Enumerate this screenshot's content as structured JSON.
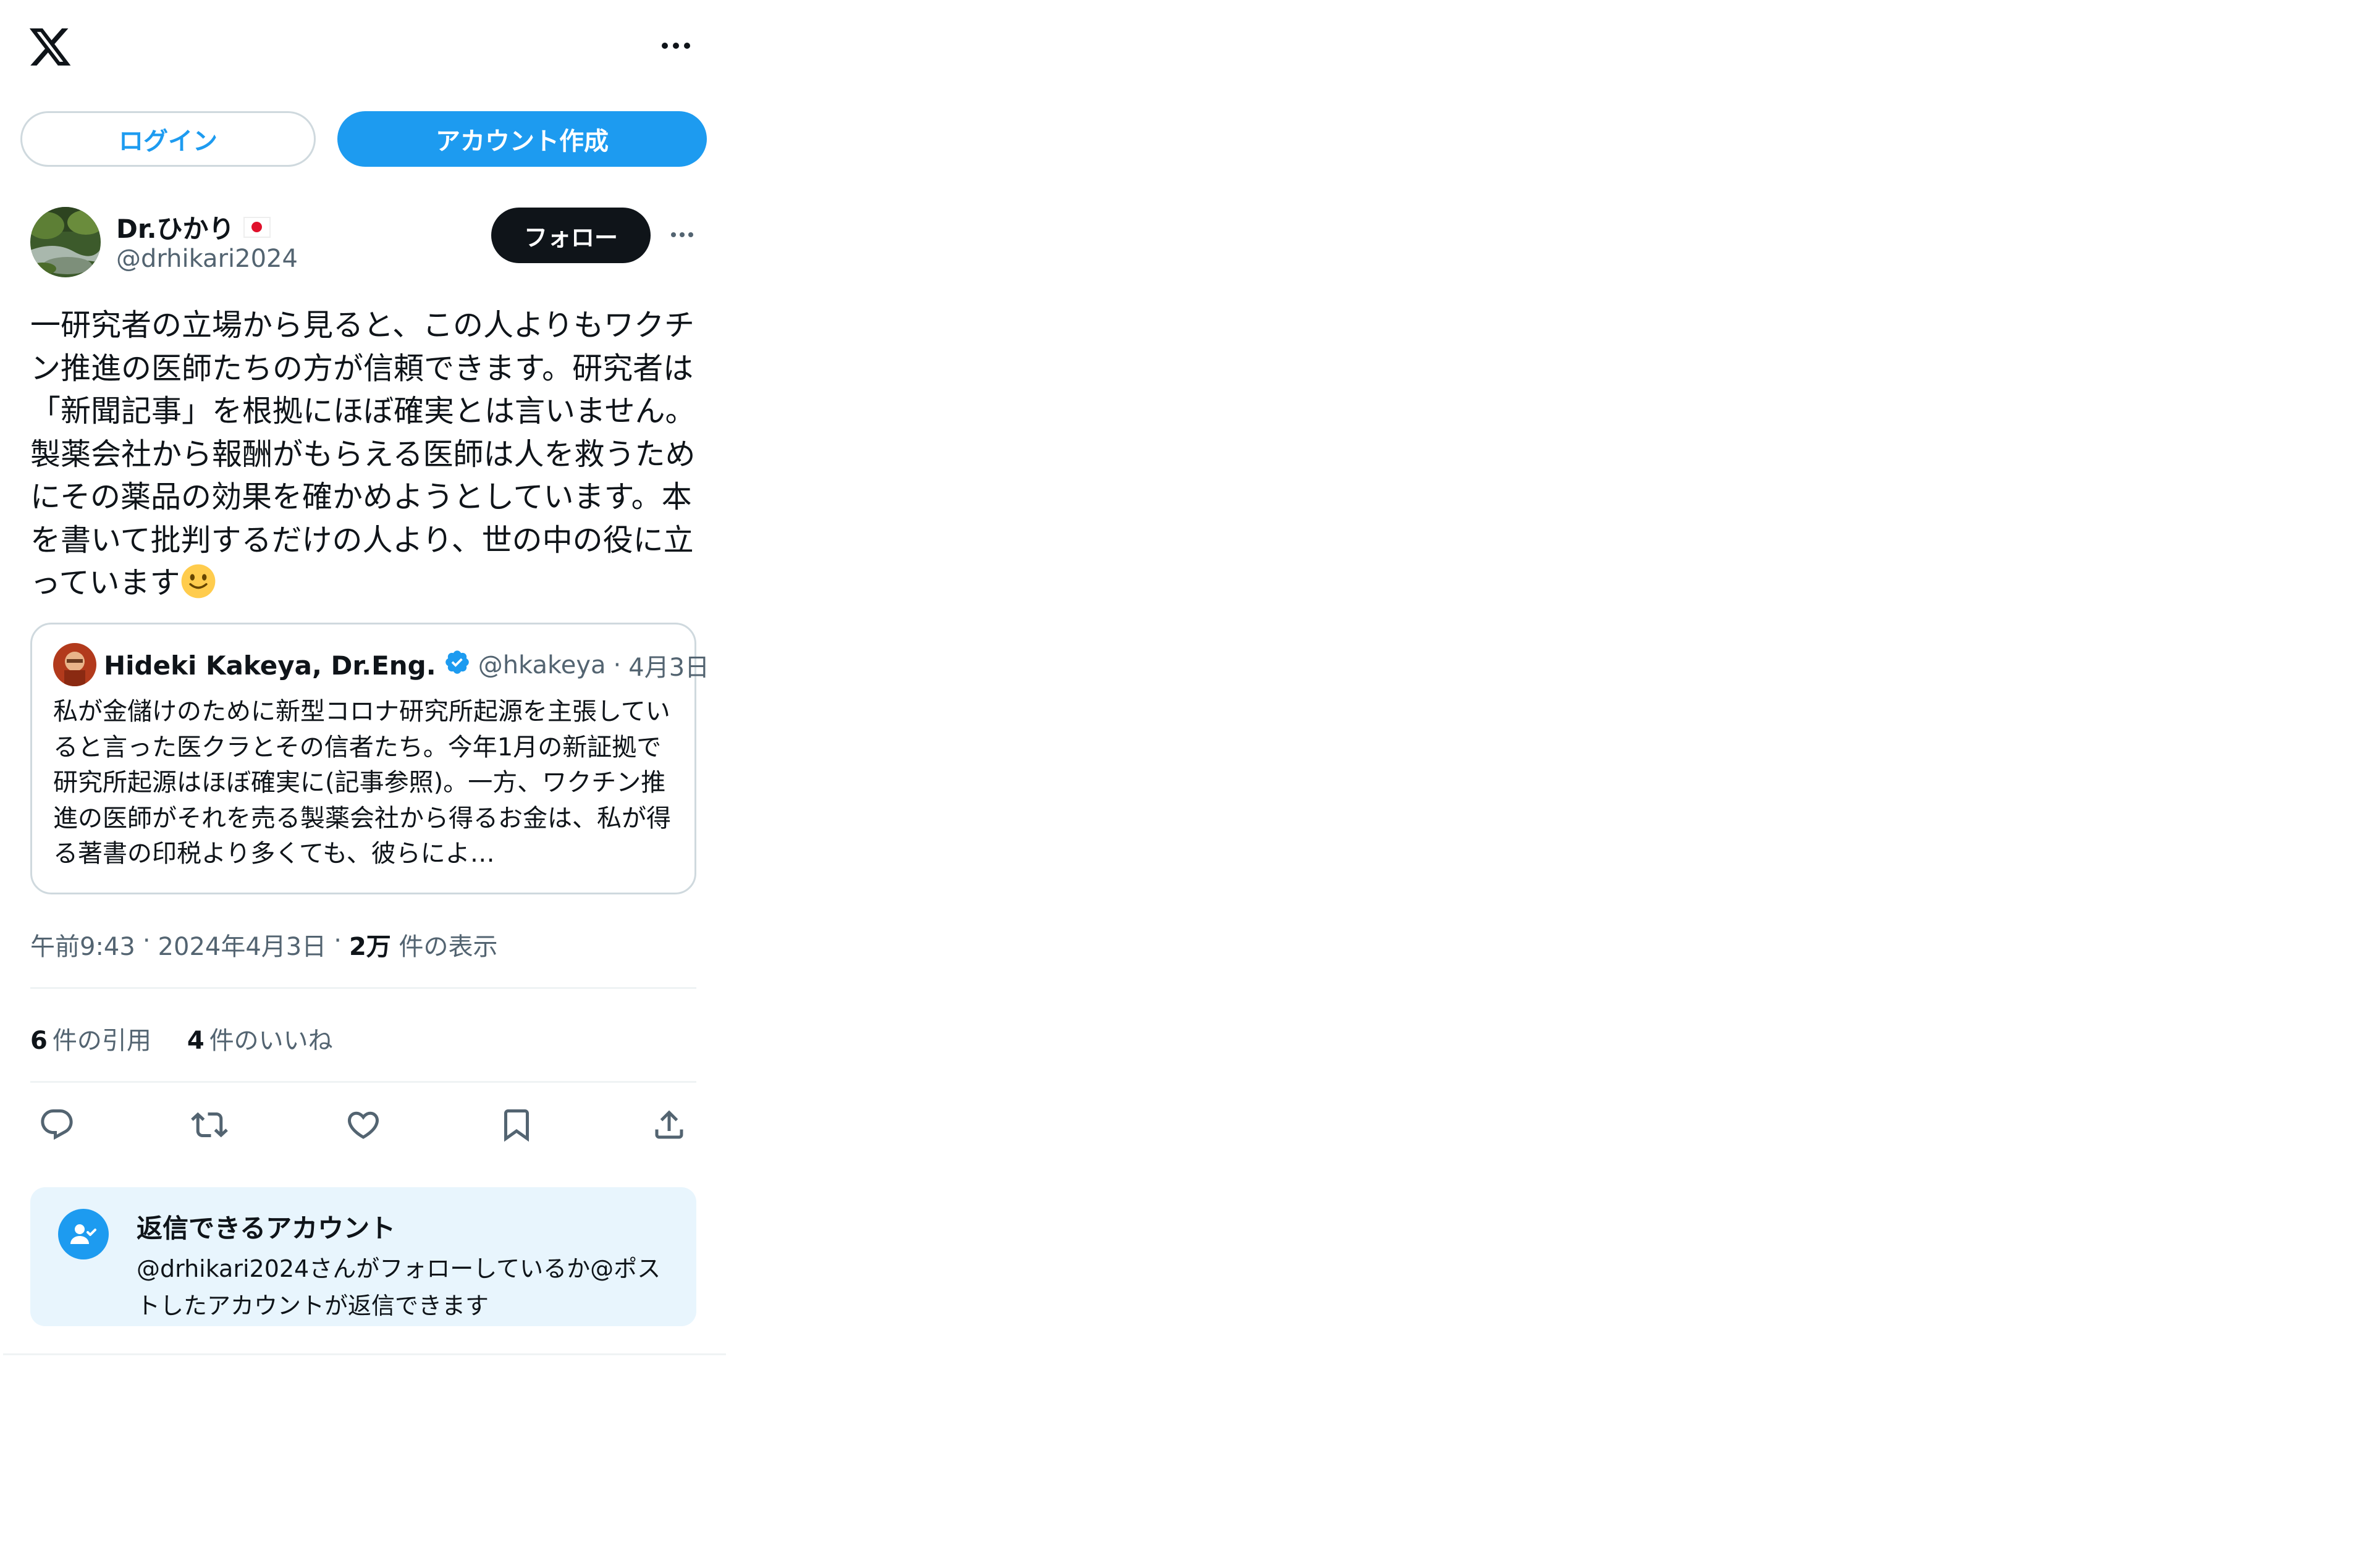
{
  "header": {
    "logo_icon": "x-logo-icon",
    "more_icon": "more-horizontal-icon",
    "login_label": "ログイン",
    "signup_label": "アカウント作成"
  },
  "post": {
    "author": {
      "name": "Dr.ひかり",
      "flag_icon": "japan-flag-icon",
      "handle": "@drhikari2024",
      "follow_label": "フォロー"
    },
    "text": "一研究者の立場から見ると、この人よりもワクチン推進の医師たちの方が信頼できます。研究者は「新聞記事」を根拠にほぼ確実とは言いません。製薬会社から報酬がもらえる医師は人を救うためにその薬品の効果を確かめようとしています。本を書いて批判するだけの人より、世の中の役に立っています",
    "emoji_icon": "slightly-smiling-face-icon",
    "quote": {
      "name": "Hideki Kakeya, Dr.Eng.",
      "verified_icon": "verified-badge-icon",
      "handle": "@hkakeya",
      "separator": "·",
      "date": "4月3日",
      "text": "私が金儲けのために新型コロナ研究所起源を主張していると言った医クラとその信者たち。今年1月の新証拠で研究所起源はほぼ確実に(記事参照)。一方、ワクチン推進の医師がそれを売る製薬会社から得るお金は、私が得る著書の印税より多くても、彼らによ…"
    },
    "meta": {
      "time": "午前9:43",
      "sep1": "·",
      "date": "2024年4月3日",
      "sep2": "·",
      "views_count": "2万",
      "views_label": "件の表示"
    },
    "stats": {
      "quotes_count": "6",
      "quotes_label": "件の引用",
      "likes_count": "4",
      "likes_label": "件のいいね"
    },
    "actions": [
      "reply-icon",
      "repost-icon",
      "like-icon",
      "bookmark-icon",
      "share-icon"
    ]
  },
  "reply_restriction": {
    "icon": "user-check-icon",
    "title": "返信できるアカウント",
    "description": "@drhikari2024さんがフォローしているか@ポストしたアカウントが返信できます"
  },
  "colors": {
    "accent": "#1d9bf0",
    "text_primary": "#0f1419",
    "text_secondary": "#536471",
    "border": "#cfd9de",
    "reply_box_bg": "#e8f5fd"
  }
}
